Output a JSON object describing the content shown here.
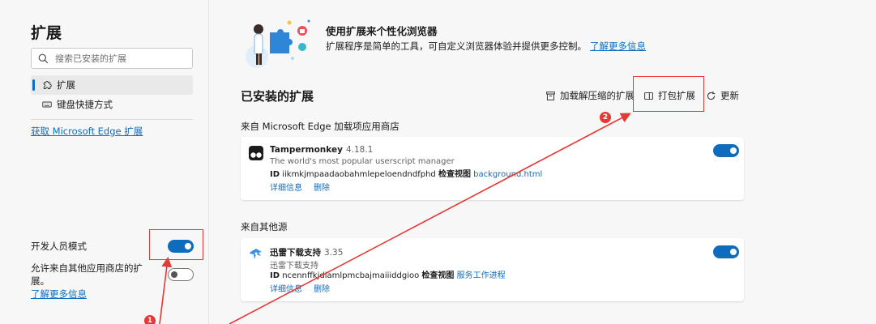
{
  "sidebar": {
    "title": "扩展",
    "search_placeholder": "搜索已安装的扩展",
    "items": [
      {
        "label": "扩展",
        "icon": "puzzle-icon",
        "active": true
      },
      {
        "label": "键盘快捷方式",
        "icon": "keyboard-icon",
        "active": false
      }
    ],
    "get_link": "获取 Microsoft Edge 扩展",
    "dev_mode_label": "开发人员模式",
    "allow_other_stores": "允许来自其他应用商店的扩展。",
    "allow_learn_more": "了解更多信息"
  },
  "hero": {
    "title": "使用扩展来个性化浏览器",
    "desc": "扩展程序是简单的工具，可自定义浏览器体验并提供更多控制。",
    "learn_more": "了解更多信息"
  },
  "installed": {
    "title": "已安装的扩展",
    "toolbar": {
      "load_unpacked": "加载解压缩的扩展",
      "pack": "打包扩展",
      "update": "更新"
    }
  },
  "sections": [
    {
      "label": "来自 Microsoft Edge 加载项应用商店",
      "extensions": [
        {
          "name": "Tampermonkey",
          "version": "4.18.1",
          "desc": "The world's most popular userscript manager",
          "id_label": "ID",
          "id": "iikmkjmpaadaobahmlepeloendndfphd",
          "inspect_label": "检查视图",
          "inspect_link": "background.html",
          "details": "详细信息",
          "remove": "删除"
        }
      ]
    },
    {
      "label": "来自其他源",
      "extensions": [
        {
          "name": "迅雷下载支持",
          "version": "3.35",
          "desc": "迅雷下载支持",
          "id_label": "ID",
          "id": "ncennffkjdiamlpmcbajmaiiiddgioo",
          "inspect_label": "检查视图",
          "inspect_link": "服务工作进程",
          "details": "详细信息",
          "remove": "删除"
        }
      ]
    }
  ],
  "annotations": {
    "badge1": "1",
    "badge2": "2",
    "color": "#e53935"
  },
  "colors": {
    "accent": "#0f6cbd",
    "background": "#f7f7f7"
  }
}
